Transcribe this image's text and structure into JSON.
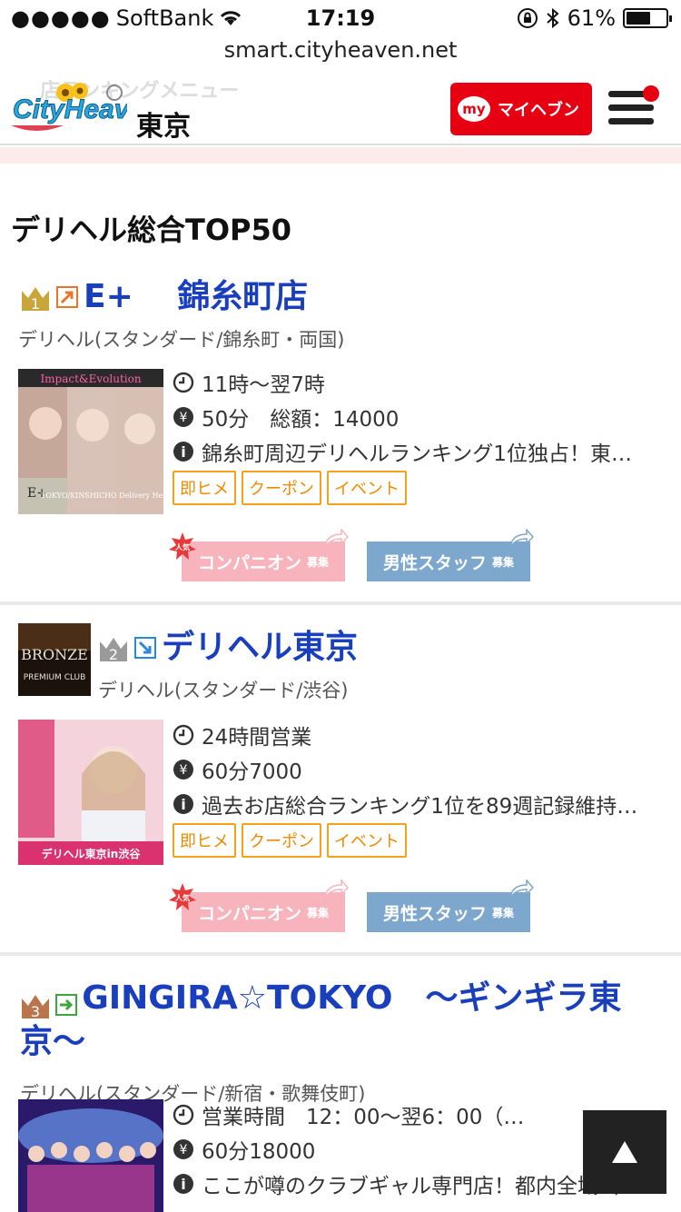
{
  "status": {
    "carrier": "SoftBank",
    "time": "17:19",
    "battery": "61%"
  },
  "url": "smart.cityheaven.net",
  "header": {
    "ghost_text": "店ランキングメニュー",
    "city": "東京",
    "myheaven_icon": "my",
    "myheaven_label": "マイヘブン",
    "logo_text": "CityHeaven.net"
  },
  "section_title": "デリヘル総合TOP50",
  "tags": [
    "即ヒメ",
    "クーポン",
    "イベント"
  ],
  "recruit": {
    "companion": "コンパニオン",
    "staff": "男性スタッフ",
    "suffix": "募集",
    "badge": "人気"
  },
  "entries": [
    {
      "rank": "1",
      "name": "E+　 錦糸町店",
      "category": "デリヘル(スタンダード/錦糸町・両国)",
      "hours": "11時〜翌7時",
      "price": "50分　総額：14000",
      "info": "錦糸町周辺デリヘルランキング1位独占！東…",
      "thumb_text": "Impact&Evolution",
      "thumb_brand": "E+",
      "thumb_sub": "TOKYO/KINSHICHO Delivery Health"
    },
    {
      "rank": "2",
      "name": "デリヘル東京",
      "category": "デリヘル(スタンダード/渋谷)",
      "hours": "24時間営業",
      "price": "60分7000",
      "info": "過去お店総合ランキング1位を89週記録維持…",
      "logo_text": "BRONZE",
      "logo_sub": "PREMIUM CLUB",
      "thumb_text": "デリヘル東京in渋谷"
    },
    {
      "rank": "3",
      "name": "GINGIRA☆TOKYO　〜ギンギラ東京〜",
      "category": "デリヘル(スタンダード/新宿・歌舞伎町)",
      "hours": "営業時間　12：00〜翌6：00（…",
      "price": "60分18000",
      "info": "ここが噂のクラブギャル専門店！都内全域出…"
    }
  ],
  "colors": {
    "shop_name": "#1a3fbd",
    "tag": "#f08a00",
    "myheaven": "#e60012"
  }
}
